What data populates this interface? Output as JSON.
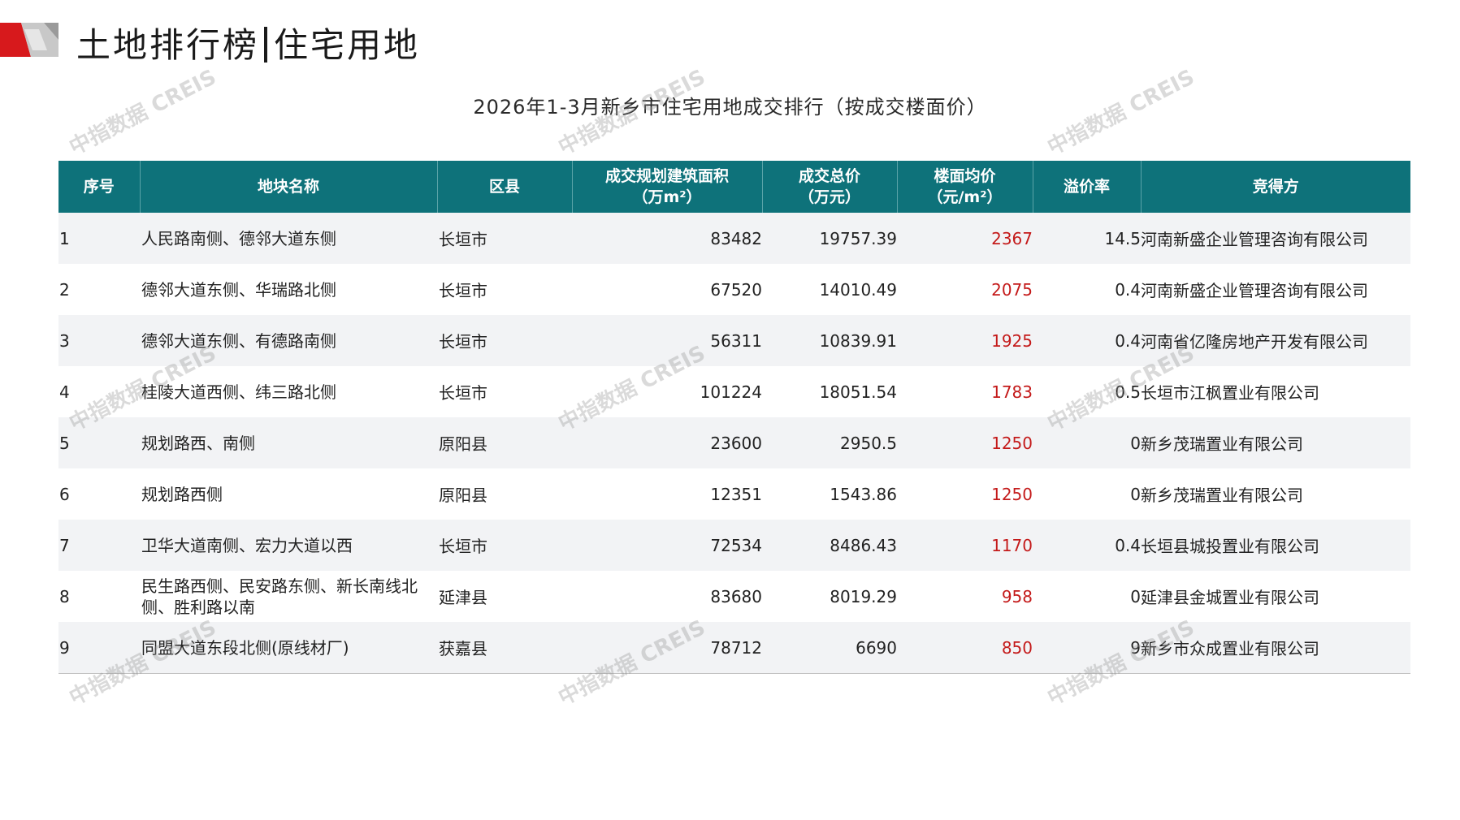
{
  "header": {
    "title_left": "土地排行榜",
    "title_right": "住宅用地"
  },
  "caption": "2026年1-3月新乡市住宅用地成交排行（按成交楼面价）",
  "watermark": "中指数据 CREIS",
  "colors": {
    "header_bg": "#0e727a",
    "price_text": "#c41a1a",
    "logo_red": "#d7191c",
    "logo_gray": "#9a9a9a"
  },
  "table": {
    "headers": [
      {
        "line1": "序号",
        "line2": ""
      },
      {
        "line1": "地块名称",
        "line2": ""
      },
      {
        "line1": "区县",
        "line2": ""
      },
      {
        "line1": "成交规划建筑面积",
        "line2": "（万m²）"
      },
      {
        "line1": "成交总价",
        "line2": "（万元）"
      },
      {
        "line1": "楼面均价",
        "line2": "（元/m²）"
      },
      {
        "line1": "溢价率",
        "line2": ""
      },
      {
        "line1": "竞得方",
        "line2": ""
      }
    ],
    "rows": [
      {
        "idx": "1",
        "name": "人民路南侧、德邻大道东侧",
        "district": "长垣市",
        "area": "83482",
        "total": "19757.39",
        "price": "2367",
        "premium": "14.5",
        "winner": "河南新盛企业管理咨询有限公司"
      },
      {
        "idx": "2",
        "name": "德邻大道东侧、华瑞路北侧",
        "district": "长垣市",
        "area": "67520",
        "total": "14010.49",
        "price": "2075",
        "premium": "0.4",
        "winner": "河南新盛企业管理咨询有限公司"
      },
      {
        "idx": "3",
        "name": "德邻大道东侧、有德路南侧",
        "district": "长垣市",
        "area": "56311",
        "total": "10839.91",
        "price": "1925",
        "premium": "0.4",
        "winner": "河南省亿隆房地产开发有限公司"
      },
      {
        "idx": "4",
        "name": "桂陵大道西侧、纬三路北侧",
        "district": "长垣市",
        "area": "101224",
        "total": "18051.54",
        "price": "1783",
        "premium": "0.5",
        "winner": "长垣市江枫置业有限公司"
      },
      {
        "idx": "5",
        "name": "规划路西、南侧",
        "district": "原阳县",
        "area": "23600",
        "total": "2950.5",
        "price": "1250",
        "premium": "0",
        "winner": "新乡茂瑞置业有限公司"
      },
      {
        "idx": "6",
        "name": "规划路西侧",
        "district": "原阳县",
        "area": "12351",
        "total": "1543.86",
        "price": "1250",
        "premium": "0",
        "winner": "新乡茂瑞置业有限公司"
      },
      {
        "idx": "7",
        "name": "卫华大道南侧、宏力大道以西",
        "district": "长垣市",
        "area": "72534",
        "total": "8486.43",
        "price": "1170",
        "premium": "0.4",
        "winner": "长垣县城投置业有限公司"
      },
      {
        "idx": "8",
        "name": "民生路西侧、民安路东侧、新长南线北侧、胜利路以南",
        "district": "延津县",
        "area": "83680",
        "total": "8019.29",
        "price": "958",
        "premium": "0",
        "winner": "延津县金城置业有限公司"
      },
      {
        "idx": "9",
        "name": "同盟大道东段北侧(原线材厂)",
        "district": "获嘉县",
        "area": "78712",
        "total": "6690",
        "price": "850",
        "premium": "9",
        "winner": "新乡市众成置业有限公司"
      }
    ]
  }
}
